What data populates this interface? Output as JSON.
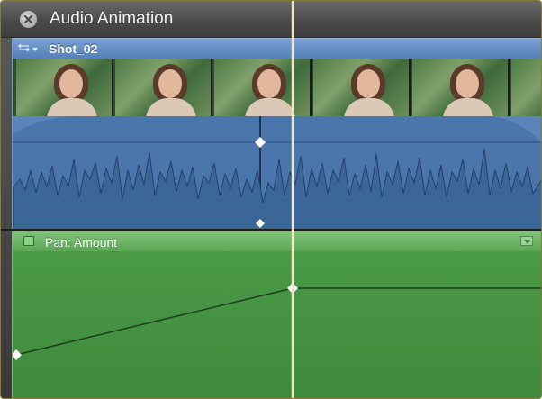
{
  "window": {
    "title": "Audio Animation",
    "close_icon": "close-icon"
  },
  "clip": {
    "name": "Shot_02",
    "menu_icon": "clip-menu-icon",
    "color": "#4f79ad",
    "thumbnail_count": 6
  },
  "pan": {
    "label": "Pan: Amount",
    "checkbox_icon": "checkbox-icon",
    "menu_icon": "disclosure-icon",
    "color": "#3f8a3e",
    "keyframes": 2
  },
  "colors": {
    "audio_blue": "#4b76ab",
    "pan_green": "#4a9a46",
    "playhead": "#f4e6b8"
  }
}
